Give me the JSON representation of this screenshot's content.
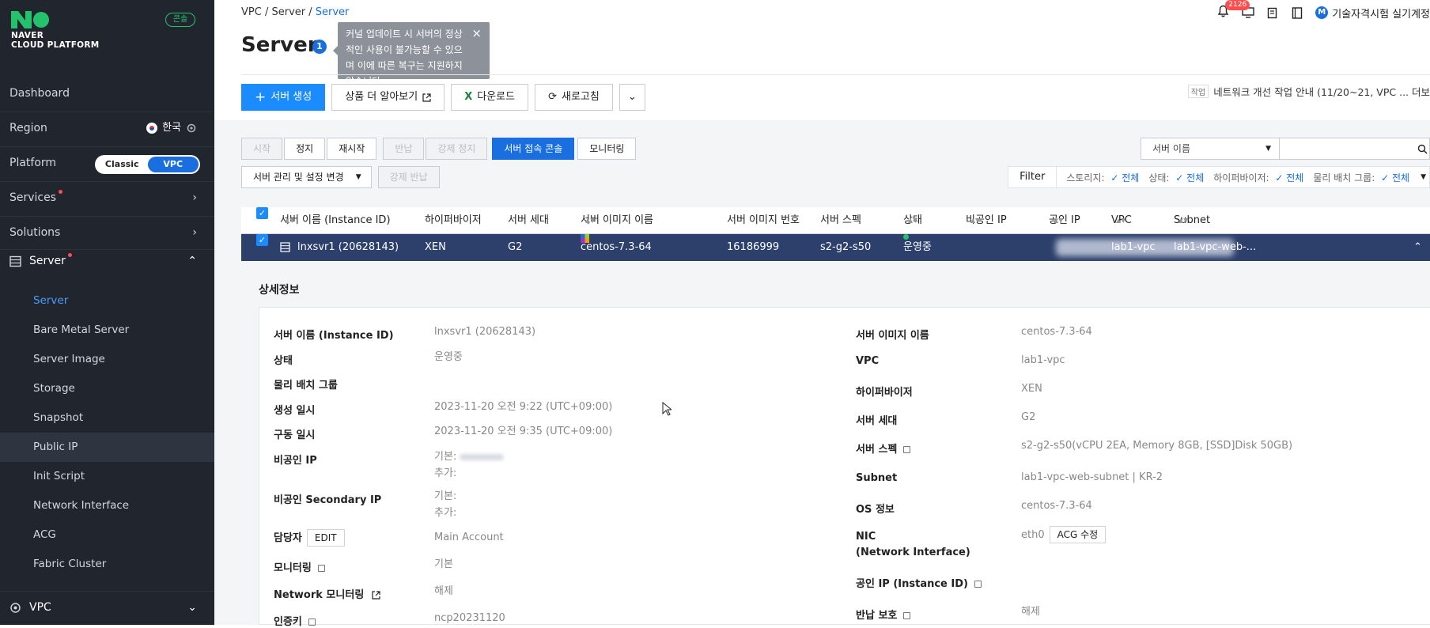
{
  "sidebar": {
    "brand_line1": "NAVER",
    "brand_line2": "CLOUD PLATFORM",
    "console_label": "콘솔",
    "dashboard": "Dashboard",
    "region_label": "Region",
    "region_value": "한국",
    "platform_label": "Platform",
    "platform_options": [
      "Classic",
      "VPC"
    ],
    "platform_selected": "VPC",
    "services": "Services",
    "solutions": "Solutions",
    "server_section": "Server",
    "server_items": [
      "Server",
      "Bare Metal Server",
      "Server Image",
      "Storage",
      "Snapshot",
      "Public IP",
      "Init Script",
      "Network Interface",
      "ACG",
      "Fabric Cluster"
    ],
    "vpc_section": "VPC"
  },
  "header": {
    "breadcrumb": [
      "VPC",
      "Server",
      "Server"
    ],
    "title": "Server",
    "info_count": "1",
    "tooltip": "커널 업데이트 시 서버의 정상적인 사용이 불가능할 수 있으며 이에 따른 복구는 지원하지 않습니다.",
    "notifications": "2126",
    "account": "기술자격시험 실기계정",
    "account_initial": "M"
  },
  "toolbar": {
    "create": "서버 생성",
    "learn_more": "상품 더 알아보기",
    "download": "다운로드",
    "refresh": "새로고침",
    "notice_tag": "작업",
    "notice": "네트워크 개선 작업 안내 (11/20~21, VPC ... 더보"
  },
  "actions": {
    "start": "시작",
    "stop": "정지",
    "restart": "재시작",
    "return": "반납",
    "force_stop": "강제 정지",
    "console": "서버 접속 콘솔",
    "monitoring": "모니터링",
    "manage": "서버 관리 및 설정 변경",
    "force_return": "강제 반납"
  },
  "search": {
    "field": "서버 이름"
  },
  "filters": {
    "title": "Filter",
    "items": [
      {
        "label": "스토리지:",
        "value": "전체"
      },
      {
        "label": "상태:",
        "value": "전체"
      },
      {
        "label": "하이퍼바이저:",
        "value": "전체"
      },
      {
        "label": "물리 배치 그룹:",
        "value": "전체"
      }
    ]
  },
  "table": {
    "headers": [
      "서버 이름 (Instance ID)",
      "하이퍼바이저",
      "서버 세대",
      "서버 이미지 이름",
      "서버 이미지 번호",
      "서버 스펙",
      "상태",
      "비공인 IP",
      "공인 IP",
      "VPC",
      "Subnet"
    ],
    "row": {
      "name": "lnxsvr1 (20628143)",
      "hypervisor": "XEN",
      "generation": "G2",
      "image_name": "centos-7.3-64",
      "image_no": "16186999",
      "spec": "s2-g2-s50",
      "status": "운영중",
      "vpc": "lab1-vpc",
      "subnet": "lab1-vpc-web-..."
    }
  },
  "detail": {
    "title": "상세정보",
    "left": [
      {
        "label": "서버 이름 (Instance ID)",
        "value": "lnxsvr1 (20628143)"
      },
      {
        "label": "상태",
        "value": "운영중"
      },
      {
        "label": "물리 배치 그룹",
        "value": ""
      },
      {
        "label": "생성 일시",
        "value": "2023-11-20 오전 9:22 (UTC+09:00)"
      },
      {
        "label": "구동 일시",
        "value": "2023-11-20 오전 9:35 (UTC+09:00)"
      },
      {
        "label": "비공인 IP",
        "value": "기본:",
        "value2": "추가:"
      },
      {
        "label": "비공인 Secondary IP",
        "value": "기본:",
        "value2": "추가:"
      },
      {
        "label": "담당자",
        "value": "Main Account",
        "button": "EDIT"
      },
      {
        "label": "모니터링",
        "value": "기본"
      },
      {
        "label": "Network 모니터링",
        "value": "해제"
      },
      {
        "label": "인증키",
        "value": "ncp20231120"
      }
    ],
    "right": [
      {
        "label": "서버 이미지 이름",
        "value": "centos-7.3-64"
      },
      {
        "label": "VPC",
        "value": "lab1-vpc"
      },
      {
        "label": "하이퍼바이저",
        "value": "XEN"
      },
      {
        "label": "서버 세대",
        "value": "G2"
      },
      {
        "label": "서버 스펙",
        "value": "s2-g2-s50(vCPU 2EA, Memory 8GB, [SSD]Disk 50GB)"
      },
      {
        "label": "Subnet",
        "value": "lab1-vpc-web-subnet | KR-2"
      },
      {
        "label": "OS 정보",
        "value": "centos-7.3-64"
      },
      {
        "label": "NIC",
        "label2": "(Network Interface)",
        "value": "eth0",
        "button": "ACG 수정"
      },
      {
        "label": "공인 IP (Instance ID)",
        "value": ""
      },
      {
        "label": "반납 보호",
        "value": "해제"
      }
    ]
  },
  "colors": {
    "accent": "#1a6fe0",
    "sidebar_bg": "#20252e",
    "selected_row": "#2d3f6b",
    "ok_green": "#25c26e"
  }
}
